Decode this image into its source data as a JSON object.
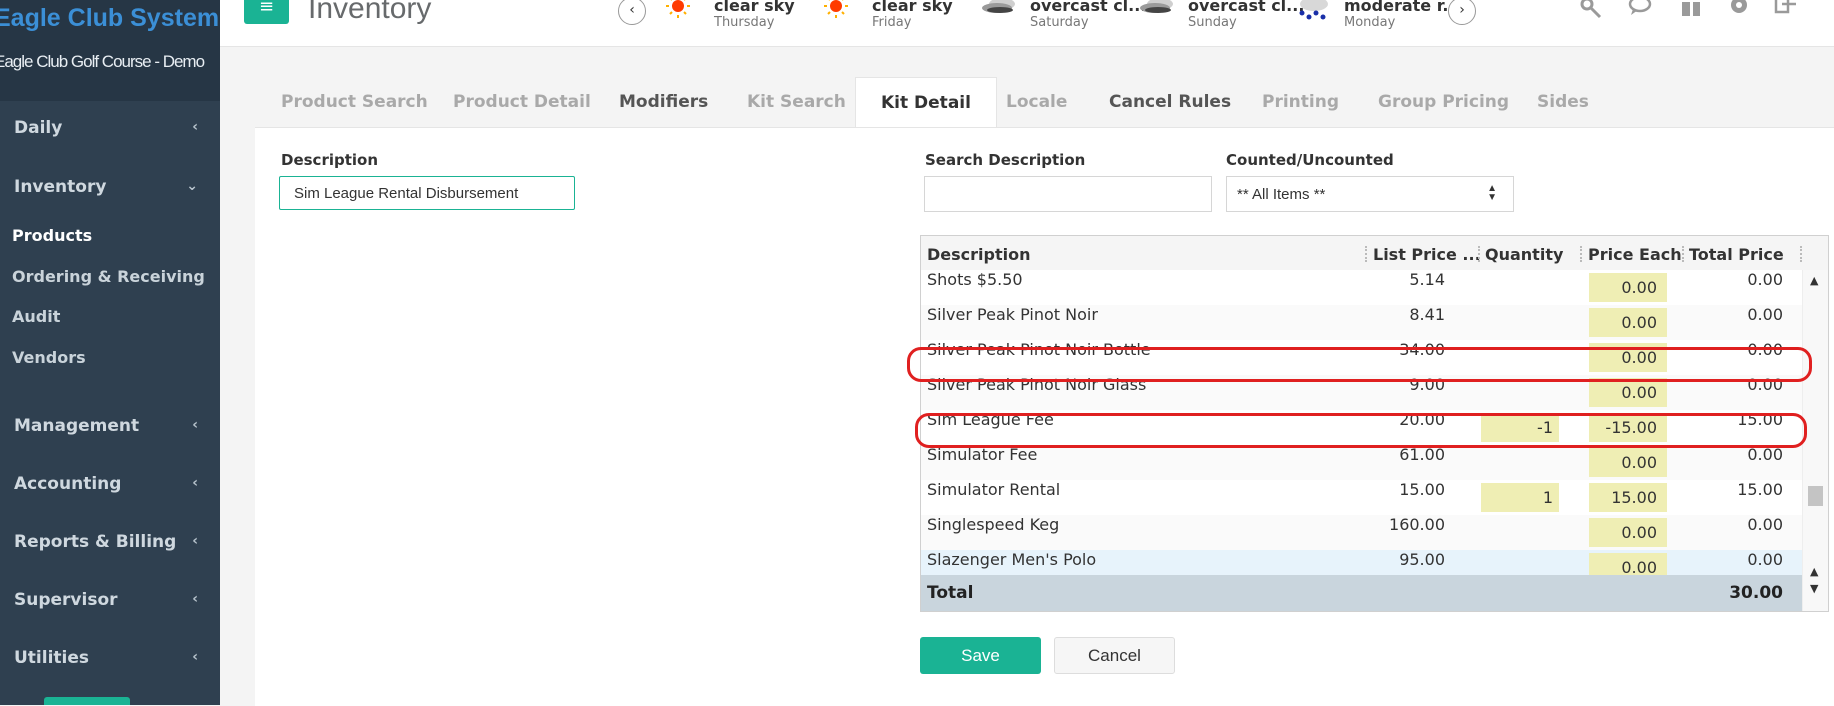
{
  "brand": {
    "logo": "Eagle Club Systems",
    "club": "Eagle Club Golf Course - Demo"
  },
  "sidebar": {
    "items": [
      {
        "label": "Daily",
        "chevron": "‹"
      },
      {
        "label": "Inventory",
        "chevron": "⌄"
      },
      {
        "label": "Management",
        "chevron": "‹"
      },
      {
        "label": "Accounting",
        "chevron": "‹"
      },
      {
        "label": "Reports & Billing",
        "chevron": "‹"
      },
      {
        "label": "Supervisor",
        "chevron": "‹"
      },
      {
        "label": "Utilities",
        "chevron": "‹"
      }
    ],
    "sub_items": [
      "Products",
      "Ordering & Receiving",
      "Audit",
      "Vendors"
    ]
  },
  "header": {
    "menu_icon": "≡",
    "title": "Inventory",
    "weather": [
      {
        "cond": "clear sky",
        "day": "Thursday",
        "icon": "sun-icon"
      },
      {
        "cond": "clear sky",
        "day": "Friday",
        "icon": "sun-icon"
      },
      {
        "cond": "overcast cl...",
        "day": "Saturday",
        "icon": "cloud-icon"
      },
      {
        "cond": "overcast cl...",
        "day": "Sunday",
        "icon": "cloud-icon"
      },
      {
        "cond": "moderate r...",
        "day": "Monday",
        "icon": "rain-icon"
      }
    ],
    "prev": "‹",
    "next": "›"
  },
  "tabs": [
    "Product Search",
    "Product Detail",
    "Modifiers",
    "Kit Search",
    "Kit Detail",
    "Locale",
    "Cancel Rules",
    "Printing",
    "Group Pricing",
    "Sides"
  ],
  "form": {
    "description_label": "Description",
    "description_value": "Sim League Rental Disbursement",
    "search_label": "Search Description",
    "search_value": "",
    "counted_label": "Counted/Uncounted",
    "counted_value": "** All Items **"
  },
  "grid": {
    "columns": [
      "Description",
      "List Price ...",
      "Quantity",
      "Price Each",
      "Total Price"
    ],
    "rows": [
      {
        "desc": "Shots $5.50",
        "list": "5.14",
        "qty": "",
        "each": "0.00",
        "total": "0.00"
      },
      {
        "desc": "Silver Peak Pinot Noir",
        "list": "8.41",
        "qty": "",
        "each": "0.00",
        "total": "0.00"
      },
      {
        "desc": "Silver Peak Pinot Noir Bottle",
        "list": "34.00",
        "qty": "",
        "each": "0.00",
        "total": "0.00"
      },
      {
        "desc": "Silver Peak Pinot Noir Glass",
        "list": "9.00",
        "qty": "",
        "each": "0.00",
        "total": "0.00"
      },
      {
        "desc": "Sim League Fee",
        "list": "20.00",
        "qty": "-1",
        "each": "-15.00",
        "total": "15.00"
      },
      {
        "desc": "Simulator Fee",
        "list": "61.00",
        "qty": "",
        "each": "0.00",
        "total": "0.00"
      },
      {
        "desc": "Simulator Rental",
        "list": "15.00",
        "qty": "1",
        "each": "15.00",
        "total": "15.00"
      },
      {
        "desc": "Singlespeed Keg",
        "list": "160.00",
        "qty": "",
        "each": "0.00",
        "total": "0.00"
      },
      {
        "desc": "Slazenger Men's Polo",
        "list": "95.00",
        "qty": "",
        "each": "0.00",
        "total": "0.00"
      }
    ],
    "total_label": "Total",
    "total_value": "30.00"
  },
  "buttons": {
    "save": "Save",
    "cancel": "Cancel"
  },
  "colors": {
    "accent": "#1ab394",
    "sidebar": "#2f4050",
    "highlight": "#e02020",
    "editable_cell": "#efeeb4"
  }
}
